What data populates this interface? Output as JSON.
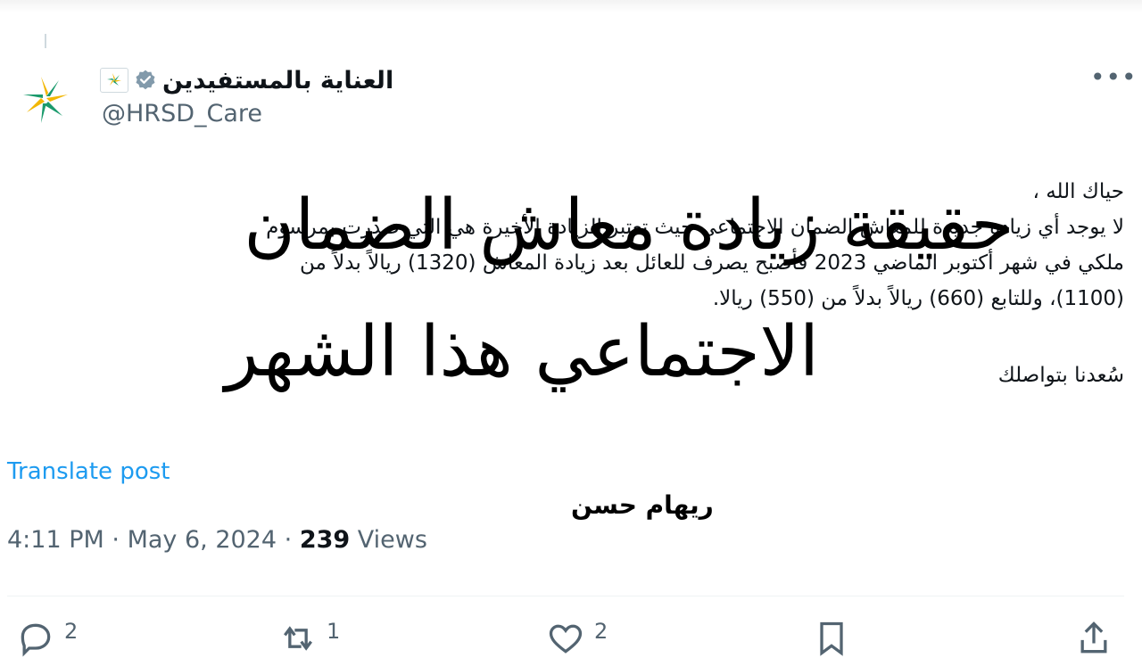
{
  "account": {
    "display_name": "العناية بالمستفيدين",
    "handle": "@HRSD_Care"
  },
  "tweet": {
    "greeting": "حياك الله ،",
    "line1": "لا يوجد أي زيادة جديدة للمعاش الضمان الاجتماعي حيث تعتبر الزيادة الأخيرة هي التي صدرت بمرسوم",
    "line2": "ملكي في شهر أكتوبر الماضي 2023 فأصبح يصرف للعائل بعد زيادة المعاش (1320) ريالاً بدلاً من",
    "line3": "(1100)، وللتابع (660) ريالاً بدلاً من (550) ريالا.",
    "signoff": "سُعدنا بتواصلك"
  },
  "overlay": {
    "headline_line1": "حقيقة زيادة معاش الضمان",
    "headline_line2": "الاجتماعي هذا الشهر",
    "author": "ريهام حسن"
  },
  "translate_label": "Translate post",
  "meta": {
    "time": "4:11 PM",
    "separator": "·",
    "date": "May 6, 2024",
    "views_count": "239",
    "views_label": "Views"
  },
  "actions": {
    "replies": "2",
    "reposts": "1",
    "likes": "2"
  },
  "icons": [
    "more-icon",
    "verified-icon",
    "flag-badge-icon",
    "reply-icon",
    "repost-icon",
    "like-icon",
    "bookmark-icon",
    "share-icon"
  ],
  "colors": {
    "link": "#1d9bf0",
    "muted": "#536471",
    "text": "#0f1419",
    "logo_green": "#1a9a6c",
    "logo_yellow": "#f2b705"
  }
}
